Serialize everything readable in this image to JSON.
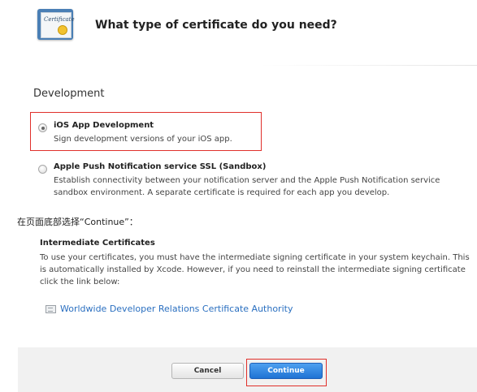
{
  "header": {
    "icon_label": "Certificate",
    "title": "What type of certificate do you need?"
  },
  "section": {
    "title": "Development"
  },
  "options": [
    {
      "title": "iOS App Development",
      "desc": "Sign development versions of your iOS app.",
      "selected": true
    },
    {
      "title": "Apple Push Notification service SSL (Sandbox)",
      "desc": "Establish connectivity between your notification server and the Apple Push Notification service sandbox environment. A separate certificate is required for each app you develop.",
      "selected": false
    }
  ],
  "instruction": "在页面底部选择“Continue”：",
  "intermediate": {
    "title": "Intermediate Certificates",
    "body": "To use your certificates, you must have the intermediate signing certificate in your system keychain. This is automatically installed by Xcode. However, if you need to reinstall the intermediate signing certificate click the link below:",
    "link": "Worldwide Developer Relations Certificate Authority"
  },
  "buttons": {
    "cancel": "Cancel",
    "continue": "Continue"
  },
  "colors": {
    "highlight": "#e0302b",
    "link": "#2a6fc0",
    "primary_button": "#1f73d4"
  }
}
